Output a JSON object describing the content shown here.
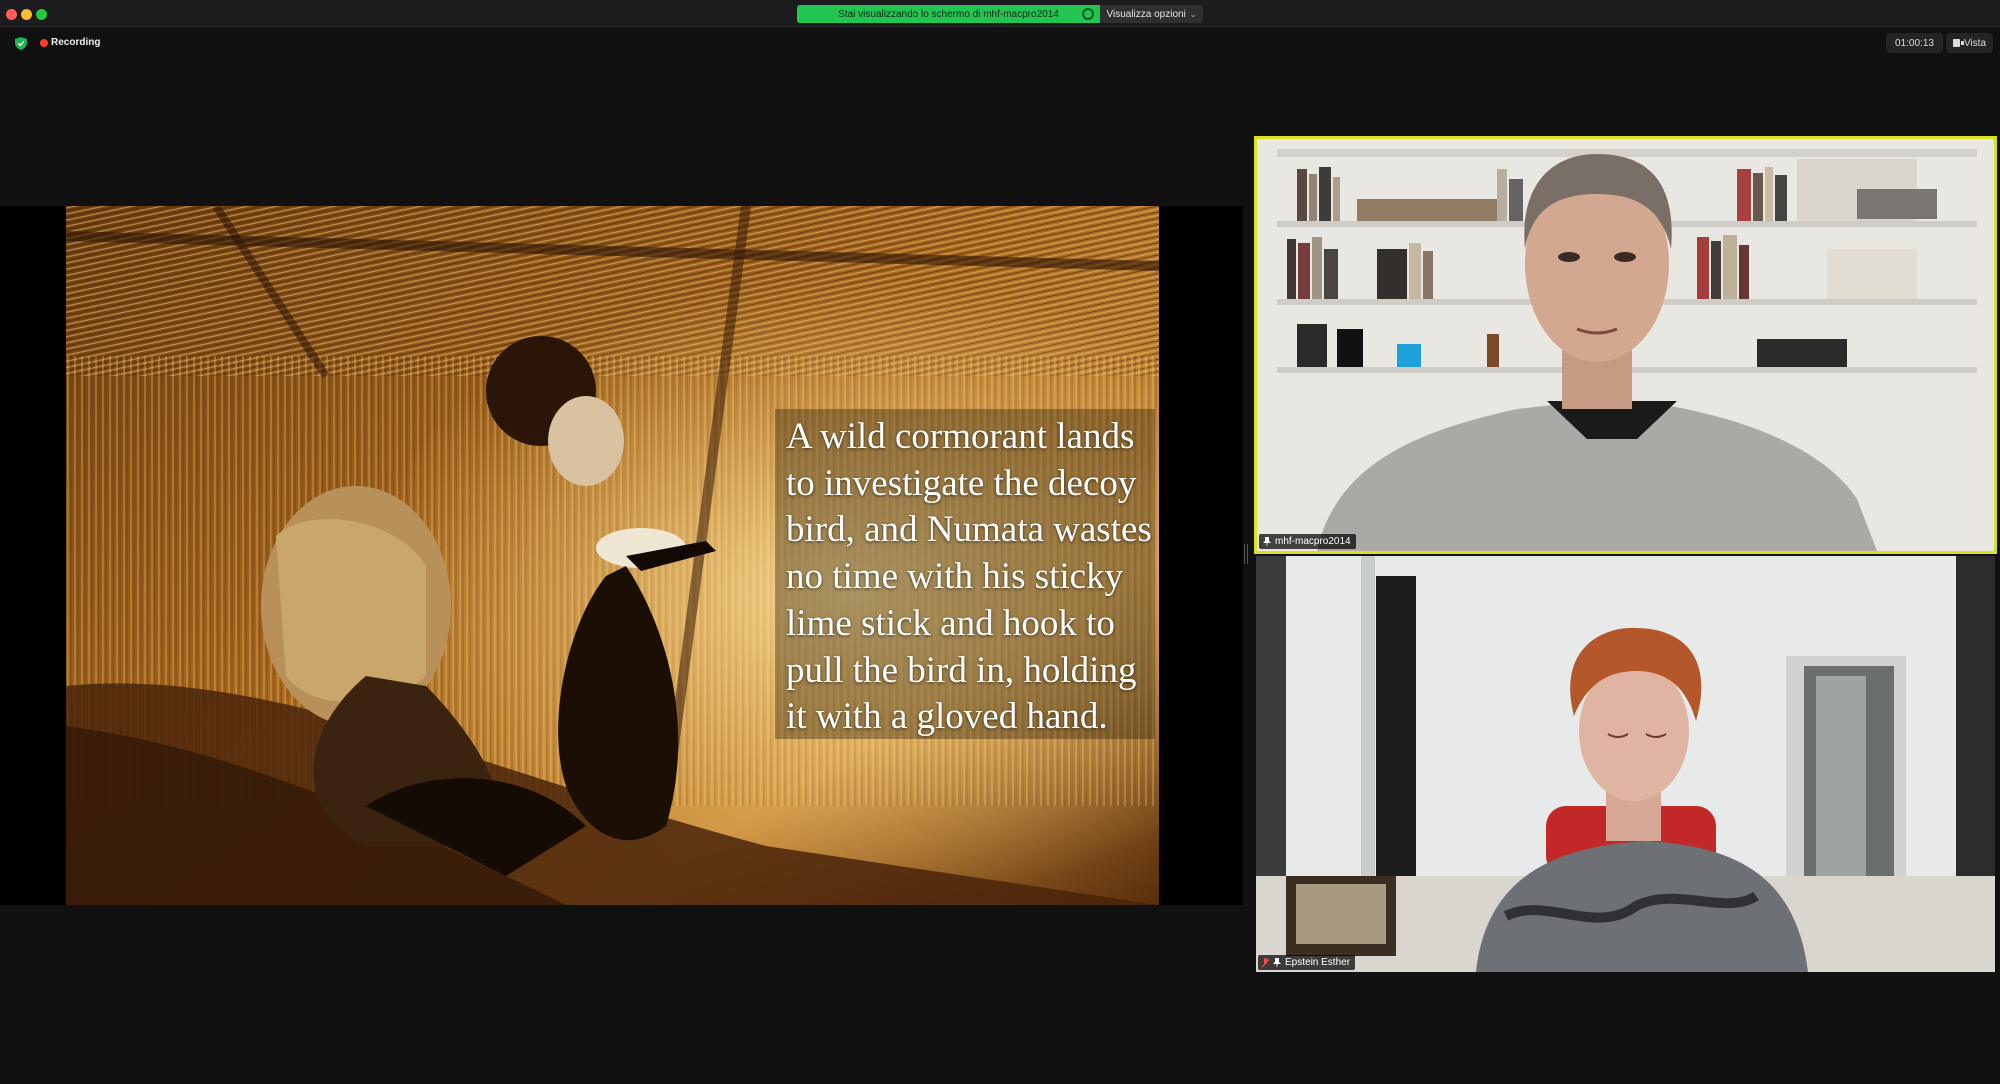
{
  "window": {
    "share_banner": "Stai visualizzando lo schermo di mhf-macpro2014",
    "view_options": "Visualizza opzioni",
    "colors": {
      "accent_green": "#23c552",
      "active_speaker": "#d9e021",
      "recording": "#ff3b30"
    }
  },
  "meeting": {
    "recording_label": "Recording",
    "timer": "01:00:13",
    "view_label": "Vista"
  },
  "slide": {
    "caption_lines": [
      "A wild cormorant lands",
      "to investigate the decoy",
      "bird, and Numata wastes",
      "no time with his sticky",
      "lime stick and hook to",
      "pull the bird in, holding",
      "it with a gloved hand."
    ]
  },
  "participants": [
    {
      "name": "mhf-macpro2014",
      "active_speaker": true
    },
    {
      "name": "Epstein Esther",
      "muted": true
    }
  ],
  "icons": {
    "security": "shield-icon",
    "recording": "record-dot-icon",
    "view": "grid-view-icon",
    "pin": "pin-icon",
    "mic_muted": "mic-muted-icon"
  }
}
